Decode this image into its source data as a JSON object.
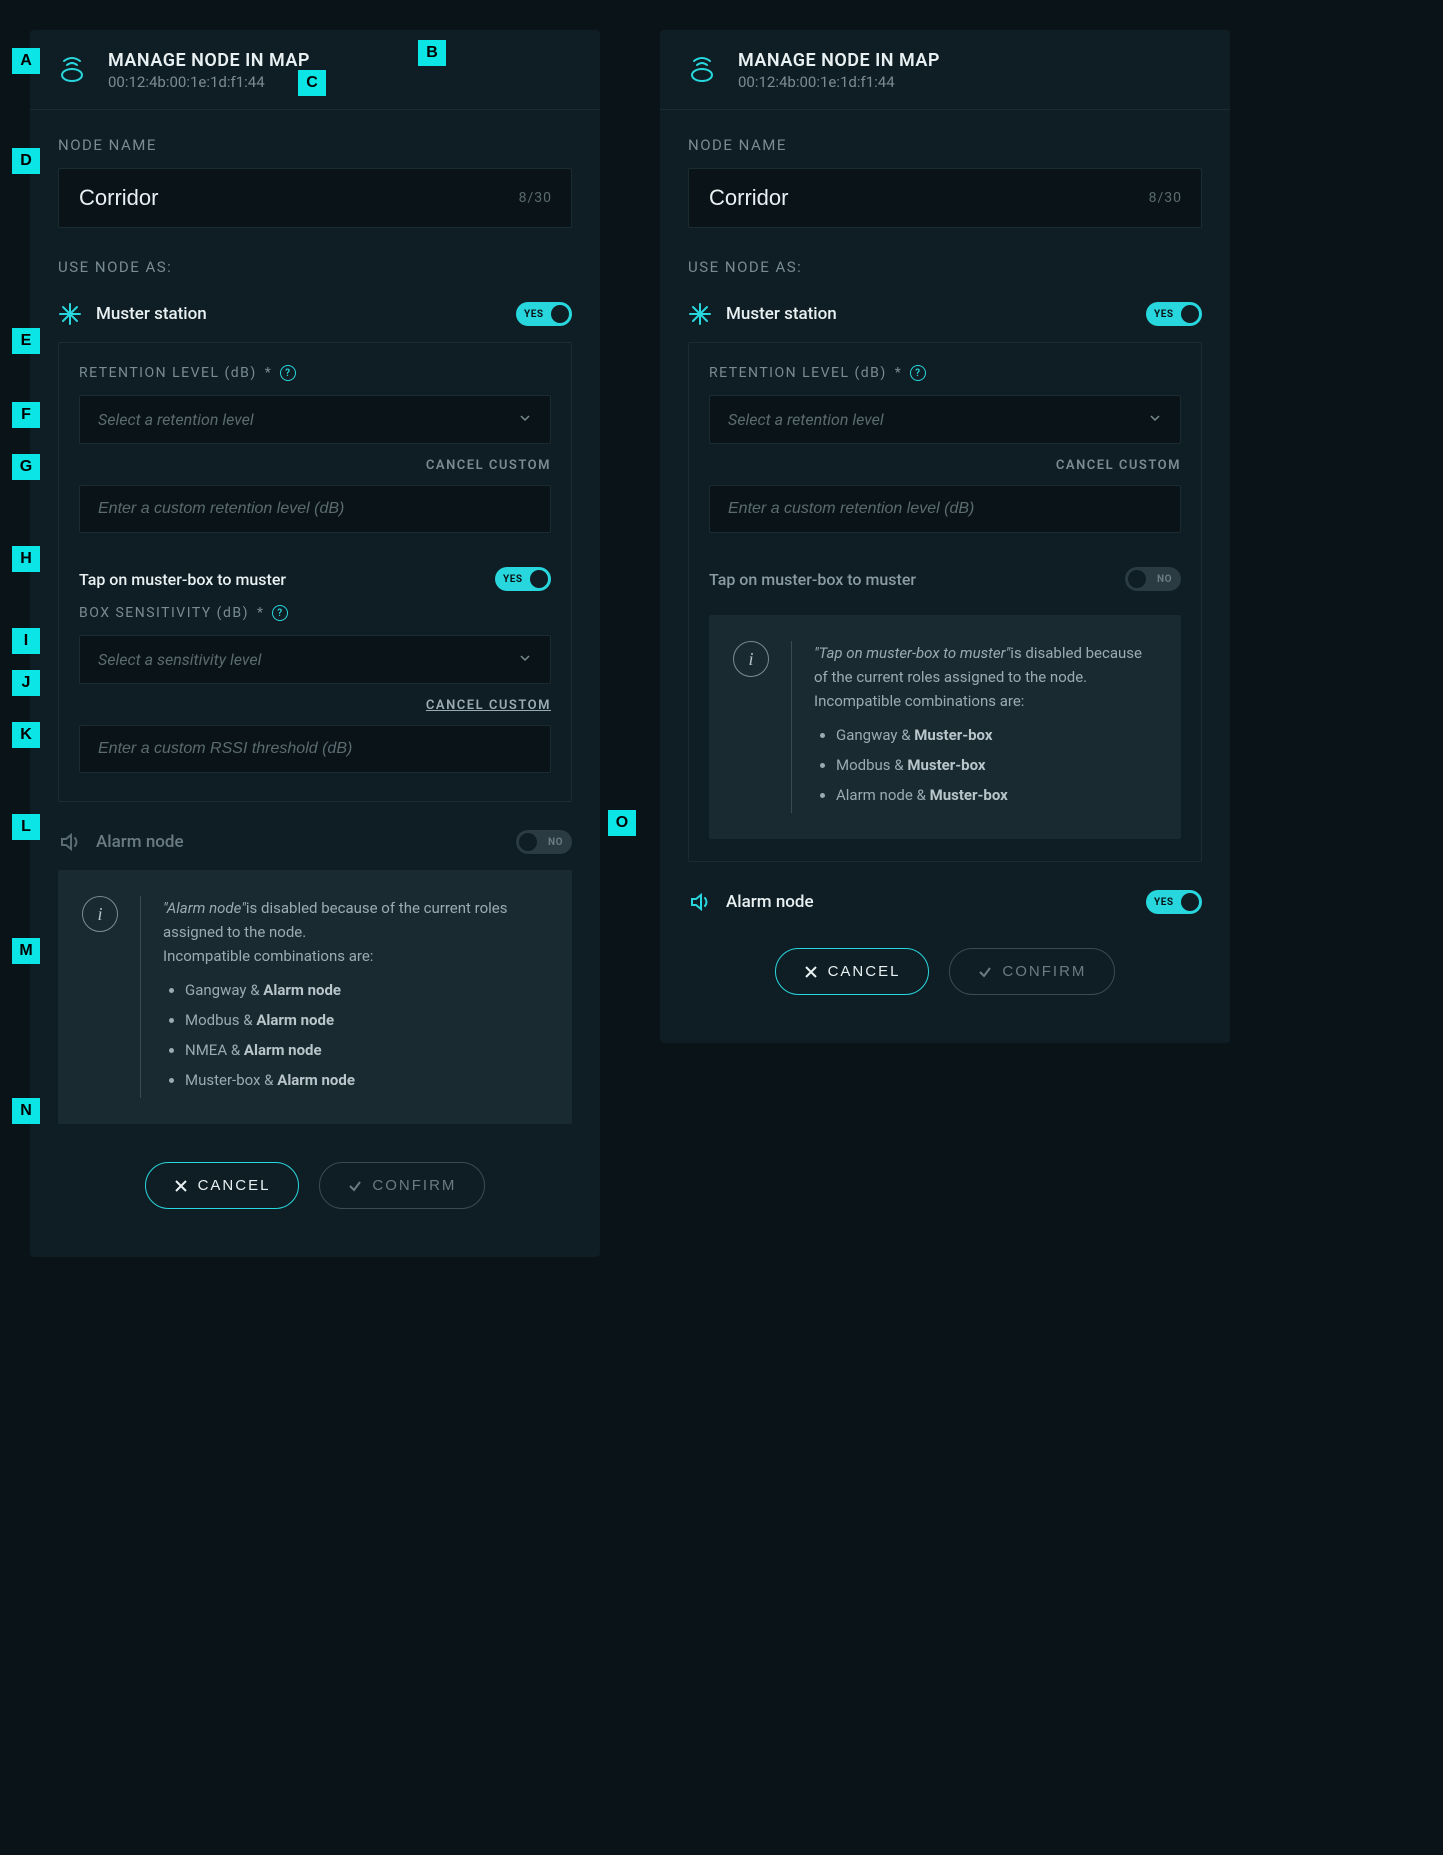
{
  "header": {
    "title": "MANAGE NODE IN MAP",
    "mac": "00:12:4b:00:1e:1d:f1:44"
  },
  "node_name": {
    "label": "NODE NAME",
    "value": "Corridor",
    "char_count": "8/30"
  },
  "use_as_label": "USE NODE AS:",
  "muster": {
    "label": "Muster station",
    "toggle_on": "YES",
    "toggle_off": "NO",
    "retention_label": "RETENTION LEVEL (dB)",
    "retention_placeholder": "Select a retention level",
    "cancel_custom": "CANCEL CUSTOM",
    "custom_placeholder": "Enter a custom retention level (dB)"
  },
  "tap": {
    "label": "Tap on muster-box to muster",
    "sensitivity_label": "BOX SENSITIVITY (dB)",
    "sensitivity_placeholder": "Select a sensitivity level",
    "cancel_custom": "CANCEL CUSTOM",
    "custom_placeholder": "Enter a custom RSSI threshold (dB)"
  },
  "alarm": {
    "label": "Alarm node"
  },
  "toggle": {
    "yes": "YES",
    "no": "NO"
  },
  "info_left": {
    "feature_quote": "\"Alarm node\"",
    "line1a": "is disabled because of the current roles assigned to the node.",
    "line2": "Incompatible combinations are:",
    "bullets": [
      {
        "a": "Gangway & ",
        "b": "Alarm node"
      },
      {
        "a": "Modbus & ",
        "b": "Alarm node"
      },
      {
        "a": "NMEA & ",
        "b": "Alarm node"
      },
      {
        "a": "Muster-box & ",
        "b": "Alarm node"
      }
    ]
  },
  "info_right": {
    "feature_quote": "\"Tap on muster-box to muster\"",
    "line1a": "is disabled because of the current roles assigned to the node.",
    "line2": "Incompatible combinations are:",
    "bullets": [
      {
        "a": "Gangway & ",
        "b": "Muster-box"
      },
      {
        "a": "Modbus & ",
        "b": "Muster-box"
      },
      {
        "a": "Alarm node & ",
        "b": "Muster-box"
      }
    ]
  },
  "buttons": {
    "cancel": "CANCEL",
    "confirm": "CONFIRM"
  },
  "markers": [
    "A",
    "B",
    "C",
    "D",
    "E",
    "F",
    "G",
    "H",
    "I",
    "J",
    "K",
    "L",
    "M",
    "N",
    "O"
  ]
}
